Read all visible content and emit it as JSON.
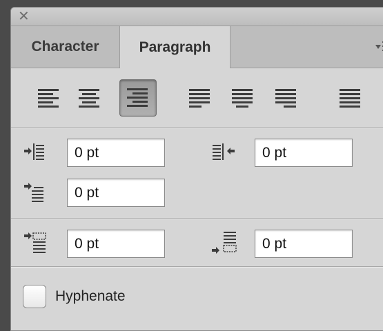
{
  "window": {
    "close_glyph": "✕",
    "collapse_glyph": "‹‹"
  },
  "tabs": [
    {
      "label": "Character",
      "active": false
    },
    {
      "label": "Paragraph",
      "active": true
    }
  ],
  "menu_icon": "panel-menu-icon",
  "alignment": {
    "buttons": [
      "align-left",
      "align-center",
      "align-right",
      "justify-last-left",
      "justify-last-center",
      "justify-last-right",
      "justify-all"
    ],
    "selected": "align-right"
  },
  "indents": {
    "left_indent": "0 pt",
    "right_indent": "0 pt",
    "first_line_indent": "0 pt"
  },
  "spacing": {
    "space_before": "0 pt",
    "space_after": "0 pt"
  },
  "hyphenate": {
    "label": "Hyphenate",
    "checked": false
  },
  "colors": {
    "panel_bg": "#d6d6d6",
    "tab_bg": "#bdbdbd",
    "selected_btn": "#a3a3a3"
  }
}
